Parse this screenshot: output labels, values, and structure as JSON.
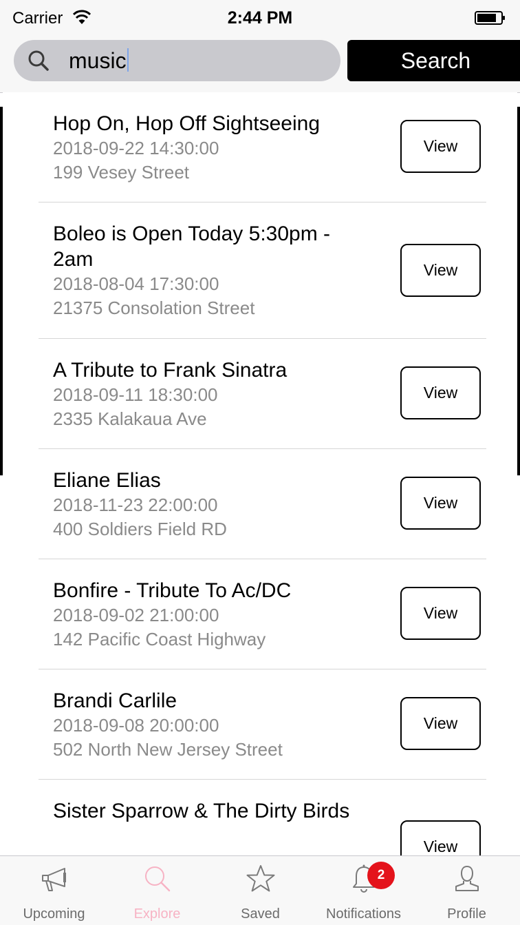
{
  "status_bar": {
    "carrier": "Carrier",
    "time": "2:44 PM"
  },
  "search": {
    "query": "music",
    "button_label": "Search"
  },
  "results": [
    {
      "title": "Hop On, Hop Off Sightseeing",
      "datetime": "2018-09-22 14:30:00",
      "address": "199 Vesey Street",
      "view_label": "View"
    },
    {
      "title": "Boleo is Open Today 5:30pm - 2am",
      "datetime": "2018-08-04 17:30:00",
      "address": "21375 Consolation Street",
      "view_label": "View"
    },
    {
      "title": "A Tribute to Frank Sinatra",
      "datetime": "2018-09-11 18:30:00",
      "address": "2335 Kalakaua Ave",
      "view_label": "View"
    },
    {
      "title": "Eliane Elias",
      "datetime": "2018-11-23 22:00:00",
      "address": "400 Soldiers Field RD",
      "view_label": "View"
    },
    {
      "title": "Bonfire - Tribute To Ac/DC",
      "datetime": "2018-09-02 21:00:00",
      "address": "142 Pacific Coast Highway",
      "view_label": "View"
    },
    {
      "title": "Brandi Carlile",
      "datetime": "2018-09-08 20:00:00",
      "address": "502 North New Jersey Street",
      "view_label": "View"
    },
    {
      "title": "Sister Sparrow & The Dirty Birds",
      "view_label": "View"
    }
  ],
  "tab_bar": {
    "upcoming": "Upcoming",
    "explore": "Explore",
    "saved": "Saved",
    "notifications": "Notifications",
    "notifications_badge": "2",
    "profile": "Profile"
  },
  "colors": {
    "active_tab": "#f7b3c4",
    "badge": "#e4131b",
    "search_button": "#000000"
  }
}
